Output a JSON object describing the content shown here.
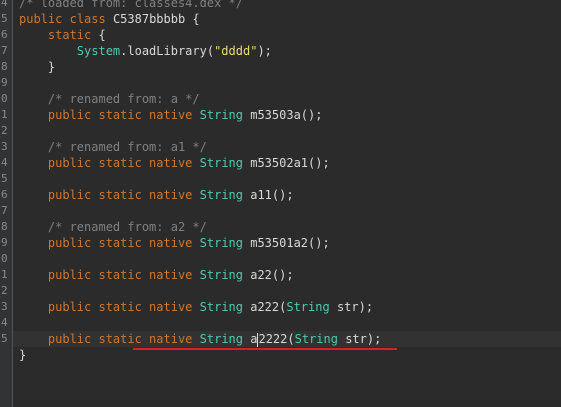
{
  "gutter": {
    "line_numbers": [
      "4",
      "5",
      "6",
      "7",
      "8",
      "9",
      "0",
      "1",
      "2",
      "3",
      "4",
      "5",
      "6",
      "7",
      "8",
      "9",
      "0",
      "1",
      "2",
      "3",
      "4",
      "5"
    ]
  },
  "code": {
    "line_01": "/* loaded from: classes4.dex */",
    "line_02_kw1": "public",
    "line_02_kw2": "class",
    "line_02_name": "C5387bbbbb {",
    "line_03_kw": "static",
    "line_03_rest": "{",
    "line_04_sys": "System",
    "line_04_call": ".loadLibrary(",
    "line_04_str": "\"dddd\"",
    "line_04_end": ");",
    "line_05": "}",
    "line_07": "/* renamed from: a */",
    "line_08_kw": "public static native",
    "line_08_type": "String",
    "line_08_name": "m53503a();",
    "line_10": "/* renamed from: a1 */",
    "line_11_kw": "public static native",
    "line_11_type": "String",
    "line_11_name": "m53502a1();",
    "line_13_kw": "public static native",
    "line_13_type": "String",
    "line_13_name": "a11();",
    "line_15": "/* renamed from: a2 */",
    "line_16_kw": "public static native",
    "line_16_type": "String",
    "line_16_name": "m53501a2();",
    "line_18_kw": "public static native",
    "line_18_type": "String",
    "line_18_name": "a22();",
    "line_20_kw": "public static native",
    "line_20_type": "String",
    "line_20_name": "a222(",
    "line_20_ptype": "String",
    "line_20_param": "str);",
    "line_22_kw": "public static native",
    "line_22_type": "String",
    "line_22_name_a": "a",
    "line_22_name_b": "2222(",
    "line_22_ptype": "String",
    "line_22_param": "str);",
    "line_23": "}"
  },
  "colors": {
    "background": "#2b2b2b",
    "keyword": "#cc7832",
    "comment": "#808080",
    "string": "#e6db74",
    "type": "#4ec9b0",
    "annotation_underline": "#d32222"
  }
}
